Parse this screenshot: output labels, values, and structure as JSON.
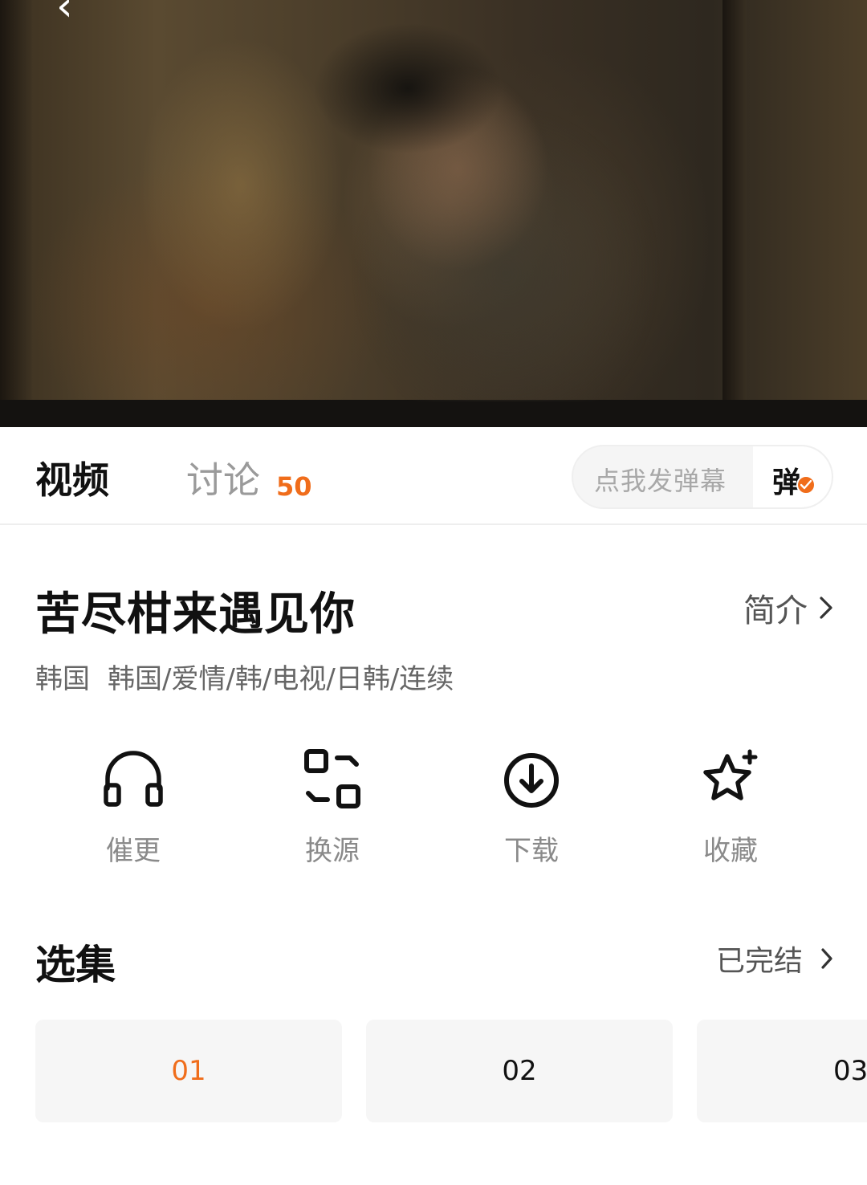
{
  "tabs": {
    "video_label": "视频",
    "discuss_label": "讨论",
    "discuss_count": "50"
  },
  "danmu": {
    "placeholder": "点我发弹幕",
    "toggle_label": "弹"
  },
  "show": {
    "title": "苦尽柑来遇见你",
    "intro_label": "简介",
    "tags": [
      "韩国",
      "韩国/爱情/韩/电视/日韩/连续"
    ]
  },
  "actions": [
    {
      "label": "催更",
      "icon": "headphones-icon"
    },
    {
      "label": "换源",
      "icon": "switch-source-icon"
    },
    {
      "label": "下载",
      "icon": "download-icon"
    },
    {
      "label": "收藏",
      "icon": "star-plus-icon"
    }
  ],
  "episodes": {
    "heading": "选集",
    "status": "已完结",
    "items": [
      "01",
      "02",
      "03"
    ]
  },
  "colors": {
    "accent": "#f06d1b",
    "text_primary": "#111111",
    "text_secondary": "#8a8a8a",
    "tile_bg": "#f6f6f6"
  }
}
